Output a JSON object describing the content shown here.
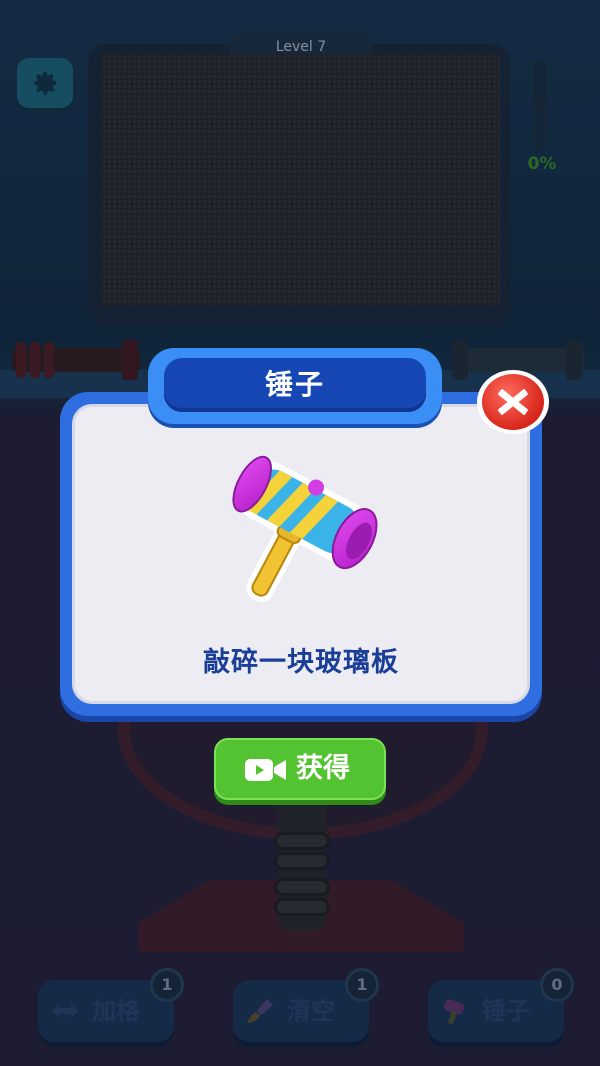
{
  "hud": {
    "level_label": "Level 7",
    "progress_text": "0%",
    "progress_fraction": 0.0
  },
  "boosters": [
    {
      "label": "加格",
      "count": "1",
      "icon": "expand-arrows-icon"
    },
    {
      "label": "清空",
      "count": "1",
      "icon": "brush-icon"
    },
    {
      "label": "锤子",
      "count": "0",
      "icon": "hammer-icon"
    }
  ],
  "popup": {
    "title": "锤子",
    "description": "敲碎一块玻璃板",
    "action_label": "获得",
    "action_icon": "video-camera-icon",
    "item_icon": "hammer-icon",
    "close_icon": "close-icon"
  },
  "colors": {
    "popup_frame": "#2f6ee0",
    "title_bar": "#1747b5",
    "action_button": "#54c331",
    "close_button": "#d7261b",
    "description_text": "#1b3f98"
  }
}
